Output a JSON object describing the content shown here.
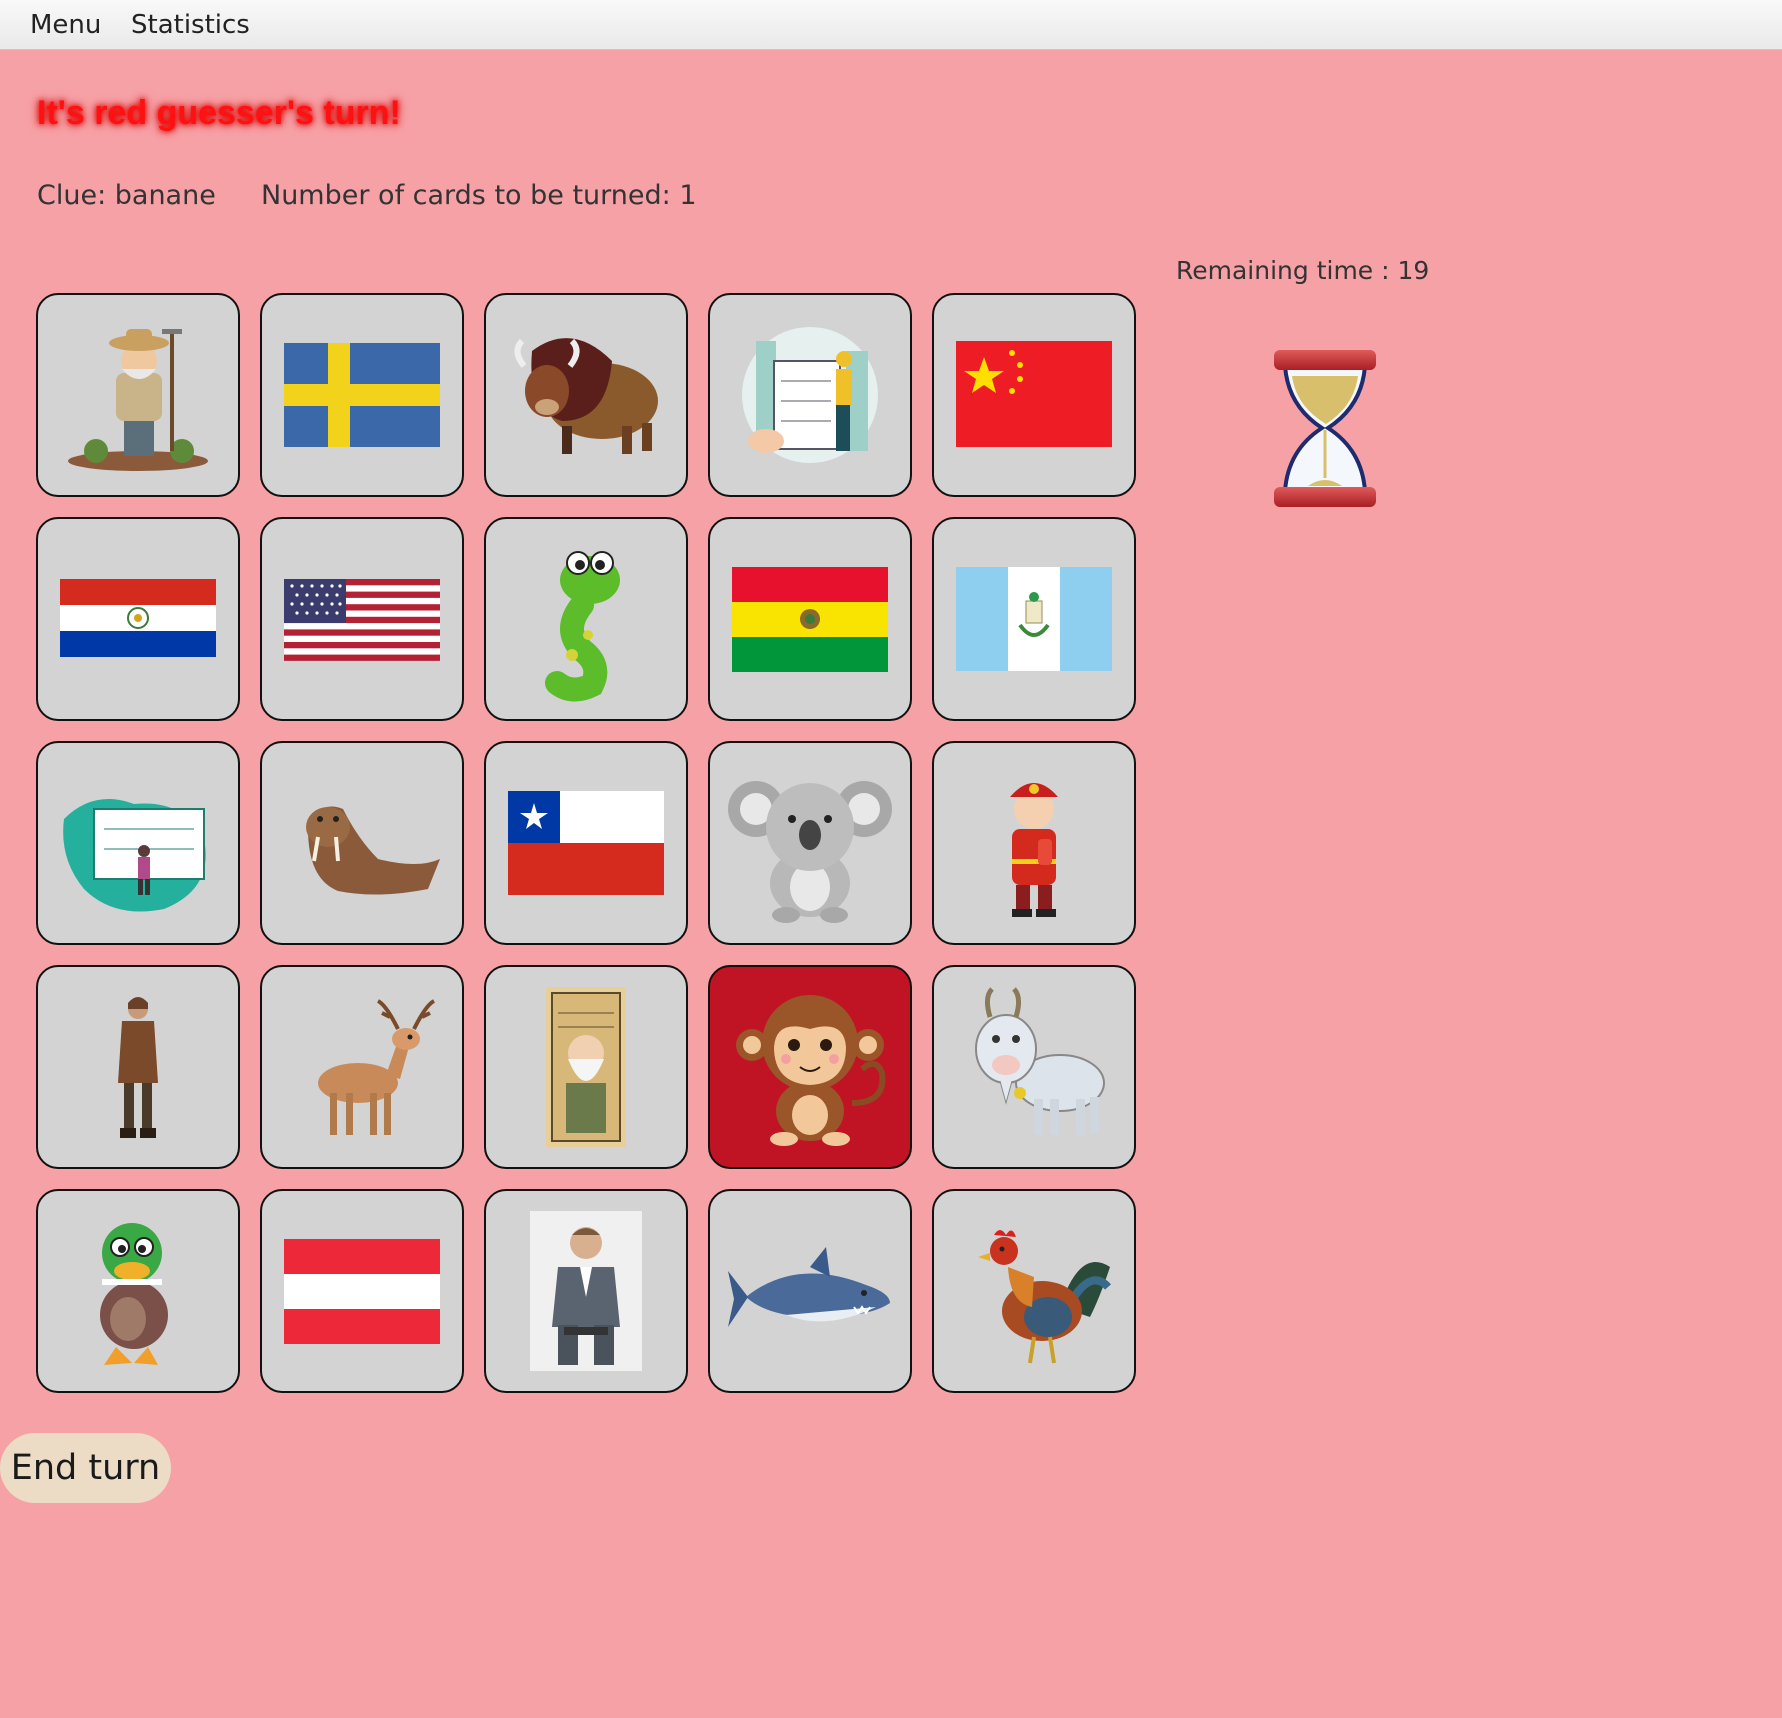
{
  "menubar": {
    "items": [
      "Menu",
      "Statistics"
    ]
  },
  "game": {
    "turn_message": "It's red guesser's turn!",
    "clue_text": "Clue: banane",
    "cards_to_turn_text": "Number of cards to be turned: 1",
    "remaining_time_text": "Remaining time : 19",
    "end_turn_label": "End turn",
    "team_color": "#ff1111",
    "revealed_card_color": "#c01424"
  },
  "cards": [
    {
      "name": "farmer",
      "revealed": false
    },
    {
      "name": "sweden-flag",
      "revealed": false
    },
    {
      "name": "bison",
      "revealed": false
    },
    {
      "name": "architect",
      "revealed": false
    },
    {
      "name": "china-flag",
      "revealed": false
    },
    {
      "name": "paraguay-flag",
      "revealed": false
    },
    {
      "name": "usa-flag",
      "revealed": false
    },
    {
      "name": "snake",
      "revealed": false
    },
    {
      "name": "bolivia-flag",
      "revealed": false
    },
    {
      "name": "guatemala-flag",
      "revealed": false
    },
    {
      "name": "engineer",
      "revealed": false
    },
    {
      "name": "walrus",
      "revealed": false
    },
    {
      "name": "chile-flag",
      "revealed": false
    },
    {
      "name": "koala",
      "revealed": false
    },
    {
      "name": "firefighter",
      "revealed": false
    },
    {
      "name": "aviator",
      "revealed": false
    },
    {
      "name": "deer",
      "revealed": false
    },
    {
      "name": "old-man",
      "revealed": false
    },
    {
      "name": "monkey",
      "revealed": true
    },
    {
      "name": "goat",
      "revealed": false
    },
    {
      "name": "duck",
      "revealed": false
    },
    {
      "name": "austria-flag",
      "revealed": false
    },
    {
      "name": "actor",
      "revealed": false
    },
    {
      "name": "shark",
      "revealed": false
    },
    {
      "name": "rooster",
      "revealed": false
    }
  ]
}
